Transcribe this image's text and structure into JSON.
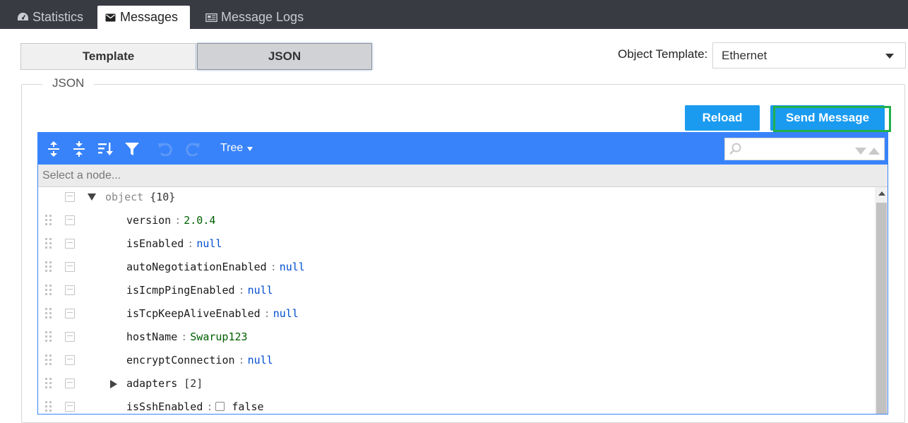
{
  "top_tabs": [
    {
      "label": "Statistics",
      "icon": "dashboard-icon"
    },
    {
      "label": "Messages",
      "icon": "envelope-icon"
    },
    {
      "label": "Message Logs",
      "icon": "newspaper-icon"
    }
  ],
  "active_tab": "Messages",
  "mode_toggle": {
    "template": "Template",
    "json": "JSON",
    "selected": "JSON"
  },
  "object_template": {
    "label": "Object Template:",
    "value": "Ethernet"
  },
  "section_legend": "JSON",
  "buttons": {
    "reload": "Reload",
    "send": "Send Message"
  },
  "colors": {
    "accent": "#3883fa",
    "button": "#1a9bf0",
    "focus": "#22b04a",
    "topbar": "#383b42"
  },
  "editor": {
    "mode": "Tree",
    "navbar_text": "Select a node...",
    "search_value": "",
    "root": {
      "key": "object",
      "count": "{10}"
    },
    "rows": [
      {
        "key": "version",
        "value": "2.0.4",
        "type": "string"
      },
      {
        "key": "isEnabled",
        "value": "null",
        "type": "null"
      },
      {
        "key": "autoNegotiationEnabled",
        "value": "null",
        "type": "null"
      },
      {
        "key": "isIcmpPingEnabled",
        "value": "null",
        "type": "null"
      },
      {
        "key": "isTcpKeepAliveEnabled",
        "value": "null",
        "type": "null"
      },
      {
        "key": "hostName",
        "value": "Swarup123",
        "type": "string"
      },
      {
        "key": "encryptConnection",
        "value": "null",
        "type": "null"
      },
      {
        "key": "adapters",
        "count": "[2]",
        "type": "array"
      },
      {
        "key": "isSshEnabled",
        "value": "false",
        "type": "boolean"
      }
    ],
    "separator": ":"
  }
}
